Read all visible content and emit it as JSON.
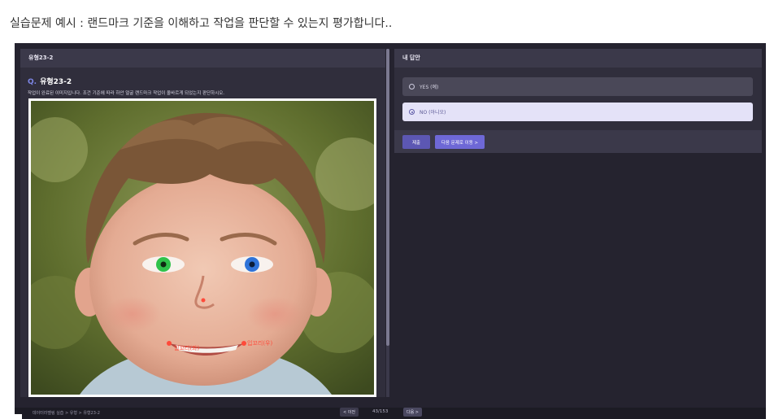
{
  "caption": "실습문제 예시 : 랜드마크 기준을 이해하고 작업을 판단할 수 있는지 평가합니다..",
  "left_panel": {
    "header": "유형23-2",
    "question_mark": "Q.",
    "question_title": "유형23-2",
    "description": "작업이 완료된 이미지입니다. 조건 기준에 따라 하안 얼굴 랜드마크 작업이 올바르게 되었는지 판단하시오."
  },
  "image": {
    "label_mouth_left": "입꼬리(좌)",
    "label_mouth_right": "입꼬리(우)",
    "left_eye_color": "#2fc24a",
    "right_eye_color": "#2f73d8",
    "landmark_color": "#ff4a3a"
  },
  "right_panel": {
    "header": "내 답안",
    "options": [
      {
        "label": "YES (예)",
        "selected": false
      },
      {
        "label": "NO (아니오)",
        "selected": true
      }
    ],
    "submit_label": "제출",
    "next_question_label": "다음 문제로 이동 >"
  },
  "bottom_bar": {
    "breadcrumb": "데이터라벨링 실습 > 유형 > 유형23-2",
    "prev_label": "< 이전",
    "page_indicator": "43/153",
    "next_label": "다음 >"
  },
  "colors": {
    "accent": "#6e68d6",
    "background": "#25232f",
    "panel": "#302e3c"
  }
}
